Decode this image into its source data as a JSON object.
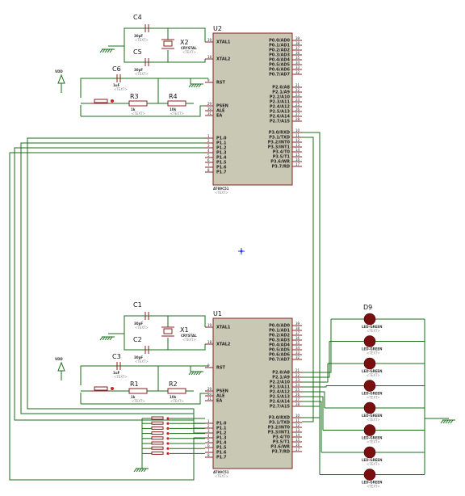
{
  "cursor_icon": "crosshair-icon",
  "colors": {
    "wire": "#1a6e1a",
    "chip_body": "#c8c8b4",
    "chip_border": "#8a1f1f",
    "led": "#7a0f0f"
  },
  "chips": [
    {
      "ref": "U2",
      "part": "AT89C51",
      "part_text": "<TEXT>",
      "left_pins": [
        {
          "name": "XTAL1",
          "num": "19"
        },
        {
          "name": "XTAL2",
          "num": "18"
        },
        {
          "name": "RST",
          "num": "9"
        },
        {
          "name": "PSEN",
          "num": "29"
        },
        {
          "name": "ALE",
          "num": "30"
        },
        {
          "name": "EA",
          "num": "31"
        },
        {
          "name": "P1.0",
          "num": "1"
        },
        {
          "name": "P1.1",
          "num": "2"
        },
        {
          "name": "P1.2",
          "num": "3"
        },
        {
          "name": "P1.3",
          "num": "4"
        },
        {
          "name": "P1.4",
          "num": "5"
        },
        {
          "name": "P1.5",
          "num": "6"
        },
        {
          "name": "P1.6",
          "num": "7"
        },
        {
          "name": "P1.7",
          "num": "8"
        }
      ],
      "right_pins": [
        {
          "name": "P0.0/AD0",
          "num": "39"
        },
        {
          "name": "P0.1/AD1",
          "num": "38"
        },
        {
          "name": "P0.2/AD2",
          "num": "37"
        },
        {
          "name": "P0.3/AD3",
          "num": "36"
        },
        {
          "name": "P0.4/AD4",
          "num": "35"
        },
        {
          "name": "P0.5/AD5",
          "num": "34"
        },
        {
          "name": "P0.6/AD6",
          "num": "33"
        },
        {
          "name": "P0.7/AD7",
          "num": "32"
        },
        {
          "name": "P2.0/A8",
          "num": "21"
        },
        {
          "name": "P2.1/A9",
          "num": "22"
        },
        {
          "name": "P2.2/A10",
          "num": "23"
        },
        {
          "name": "P2.3/A11",
          "num": "24"
        },
        {
          "name": "P2.4/A12",
          "num": "25"
        },
        {
          "name": "P2.5/A13",
          "num": "26"
        },
        {
          "name": "P2.6/A14",
          "num": "27"
        },
        {
          "name": "P2.7/A15",
          "num": "28"
        },
        {
          "name": "P3.0/RXD",
          "num": "10"
        },
        {
          "name": "P3.1/TXD",
          "num": "11"
        },
        {
          "name": "P3.2/INT0",
          "num": "12"
        },
        {
          "name": "P3.3/INT1",
          "num": "13"
        },
        {
          "name": "P3.4/T0",
          "num": "14"
        },
        {
          "name": "P3.5/T1",
          "num": "15"
        },
        {
          "name": "P3.6/WR",
          "num": "16"
        },
        {
          "name": "P3.7/RD",
          "num": "17"
        }
      ]
    },
    {
      "ref": "U1",
      "part": "AT89C51",
      "part_text": "<TEXT>"
    }
  ],
  "components": {
    "top": {
      "cap1": {
        "ref": "C4",
        "val": "30pF",
        "text": "<TEXT>"
      },
      "cap2": {
        "ref": "C5",
        "val": "30pF",
        "text": "<TEXT>"
      },
      "crystal": {
        "ref": "X2",
        "val": "CRYSTAL",
        "text": "<TEXT>"
      },
      "cap3": {
        "ref": "C6",
        "val": "1uF",
        "text": "<TEXT>"
      },
      "res1": {
        "ref": "R3",
        "val": "1k",
        "text": "<TEXT>"
      },
      "res2": {
        "ref": "R4",
        "val": "10k",
        "text": "<TEXT>"
      },
      "vdd": "VDD"
    },
    "bottom": {
      "cap1": {
        "ref": "C1",
        "val": "30pF",
        "text": "<TEXT>"
      },
      "cap2": {
        "ref": "C2",
        "val": "30pF",
        "text": "<TEXT>"
      },
      "crystal": {
        "ref": "X1",
        "val": "CRYSTAL",
        "text": "<TEXT>"
      },
      "cap3": {
        "ref": "C3",
        "val": "1uF",
        "text": "<TEXT>"
      },
      "res1": {
        "ref": "R1",
        "val": "1k",
        "text": "<TEXT>"
      },
      "res2": {
        "ref": "R2",
        "val": "10k",
        "text": "<TEXT>"
      },
      "vdd": "VDD"
    }
  },
  "leds": {
    "first_ref": "D9",
    "items": [
      {
        "val": "LED-GREEN",
        "text": "<TEXT>"
      },
      {
        "val": "LED-GREEN",
        "text": "<TEXT>"
      },
      {
        "val": "LED-GREEN",
        "text": "<TEXT>"
      },
      {
        "val": "LED-GREEN",
        "text": "<TEXT>"
      },
      {
        "val": "LED-GREEN",
        "text": "<TEXT>"
      },
      {
        "val": "LED-GREEN",
        "text": "<TEXT>"
      },
      {
        "val": "LED-GREEN",
        "text": "<TEXT>"
      },
      {
        "val": "LED-GREEN",
        "text": "<TEXT>"
      }
    ]
  }
}
